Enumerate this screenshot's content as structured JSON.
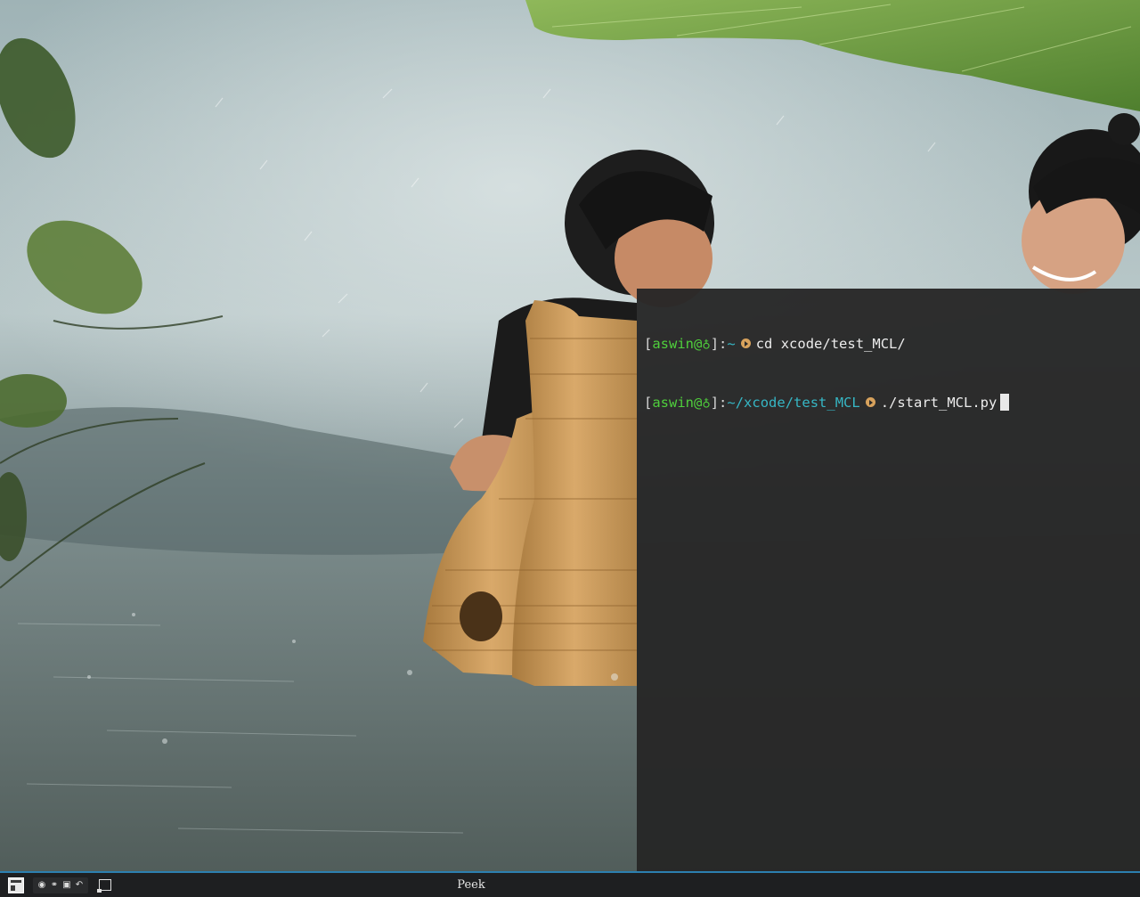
{
  "terminal": {
    "lines": [
      {
        "bracket_open": "[",
        "user": "aswin@",
        "host_glyph": "♁",
        "bracket_close": "]",
        "colon": ":",
        "path": "~",
        "command": "cd xcode/test_MCL/"
      },
      {
        "bracket_open": "[",
        "user": "aswin@",
        "host_glyph": "♁",
        "bracket_close": "]",
        "colon": ":",
        "path": "~/xcode/test_MCL",
        "command": "./start_MCL.py"
      }
    ]
  },
  "taskbar": {
    "active_window_title": "Peek",
    "tray_icons": [
      "browser-icon",
      "link-icon",
      "image-viewer-icon",
      "undo-icon"
    ]
  },
  "colors": {
    "prompt_user": "#4fcf3c",
    "prompt_path": "#36b6c4",
    "prompt_arrow": "#d8a25c",
    "terminal_bg": "#262626",
    "taskbar_bg": "#1e1f21",
    "taskbar_accent": "#2c7fb0"
  }
}
